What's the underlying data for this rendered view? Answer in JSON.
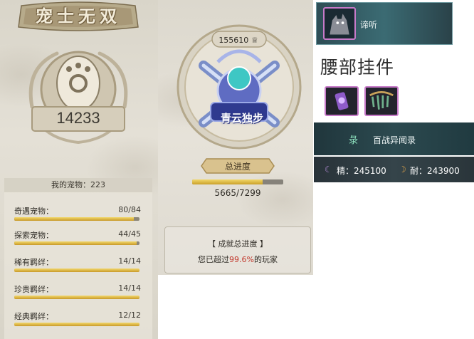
{
  "left_panel": {
    "title": "宠士无双",
    "score": "14233",
    "my_pets_label": "我的宠物：223",
    "rows": [
      {
        "label": "奇遇宠物：",
        "value": "80/84",
        "progress": 0.952
      },
      {
        "label": "探索宠物：",
        "value": "44/45",
        "progress": 0.978
      },
      {
        "label": "稀有羁绊：",
        "value": "14/14",
        "progress": 1.0
      },
      {
        "label": "珍贵羁绊：",
        "value": "14/14",
        "progress": 1.0
      },
      {
        "label": "经典羁绊：",
        "value": "12/12",
        "progress": 1.0
      }
    ]
  },
  "achievement_panel": {
    "points": "155610",
    "emblem_text": "青云独步",
    "progress_label": "总进度",
    "progress_value": "5665/7299",
    "progress_fraction": 0.776,
    "summary_title": "【 成就总进度 】",
    "summary_prefix": "您已超过",
    "summary_percent": "99.6%",
    "summary_suffix": "的玩家"
  },
  "right_panel": {
    "mount_name": "谛听",
    "waist_title": "腰部挂件",
    "record_icon": "彔",
    "record_name": "百战异闻录",
    "stat_jing": "精：245100",
    "stat_nai": "耐：243900"
  },
  "colors": {
    "progress_gold": "#e2b93b",
    "highlight_red": "#c23a2e",
    "rarity_purple": "#c77ac9",
    "teal_bar": "#2e4d55"
  },
  "icons": [
    "paw-icon",
    "trophy-icon",
    "wolf-icon",
    "lamp-icon",
    "branch-icon",
    "moon-icon"
  ]
}
